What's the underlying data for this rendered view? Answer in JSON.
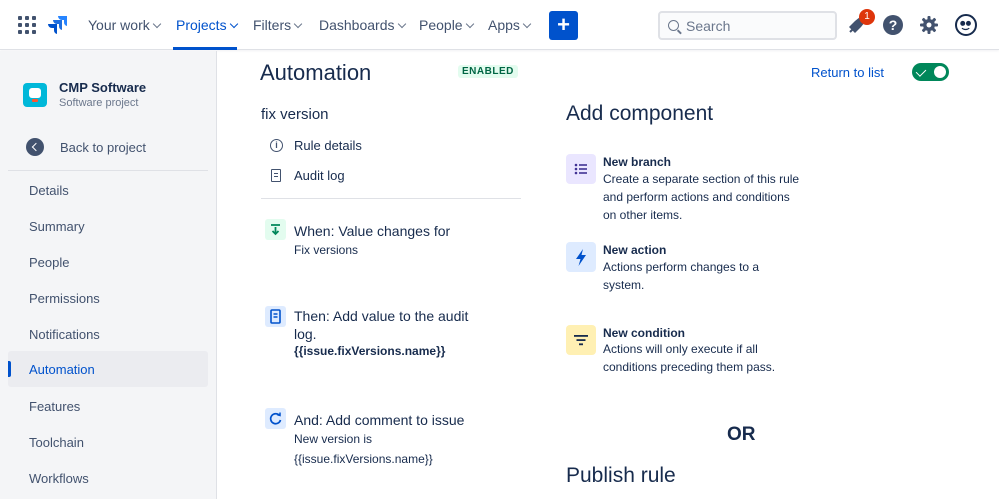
{
  "topnav": {
    "items": [
      {
        "label": "Your work",
        "active": false
      },
      {
        "label": "Projects",
        "active": true
      },
      {
        "label": "Filters",
        "active": false
      },
      {
        "label": "Dashboards",
        "active": false
      },
      {
        "label": "People",
        "active": false
      },
      {
        "label": "Apps",
        "active": false
      }
    ],
    "create_label": "+",
    "search_placeholder": "Search",
    "notification_count": "1",
    "help_label": "?",
    "icons": [
      "app-grid-icon",
      "jira-logo-icon",
      "notification-icon",
      "help-icon",
      "gear-icon",
      "avatar"
    ],
    "accent_color": "#0052cc",
    "badge_color": "#de350b"
  },
  "sidebar": {
    "project_name": "CMP Software",
    "project_type": "Software project",
    "back_label": "Back to project",
    "items": [
      {
        "label": "Details",
        "active": false
      },
      {
        "label": "Summary",
        "active": false
      },
      {
        "label": "People",
        "active": false
      },
      {
        "label": "Permissions",
        "active": false
      },
      {
        "label": "Notifications",
        "active": false
      },
      {
        "label": "Automation",
        "active": true
      },
      {
        "label": "Features",
        "active": false
      },
      {
        "label": "Toolchain",
        "active": false
      },
      {
        "label": "Workflows",
        "active": false
      }
    ]
  },
  "main": {
    "title": "Automation",
    "status": "ENABLED",
    "return_link": "Return to list",
    "rule_enabled": true,
    "rule_name": "fix version",
    "rule_links": [
      {
        "label": "Rule details",
        "icon": "info-icon"
      },
      {
        "label": "Audit log",
        "icon": "document-icon"
      }
    ],
    "steps": [
      {
        "title": "When: Value changes for",
        "line1": "Fix versions",
        "line2": "",
        "icon": "trigger-icon"
      },
      {
        "title": "Then: Add value to the audit log.",
        "line1": "{{issue.fixVersions.name}}",
        "line2": "",
        "icon": "audit-log-action-icon"
      },
      {
        "title": "And: Add comment to issue",
        "line1": "New version is",
        "line2": "{{issue.fixVersions.name}}",
        "icon": "comment-action-icon"
      }
    ]
  },
  "add_component": {
    "title": "Add component",
    "components": [
      {
        "name": "New branch",
        "desc": "Create a separate section of this rule and perform actions and conditions on other items.",
        "icon": "branch-list-icon"
      },
      {
        "name": "New action",
        "desc": "Actions perform changes to a system.",
        "icon": "lightning-icon"
      },
      {
        "name": "New condition",
        "desc": "Actions will only execute if all conditions preceding them pass.",
        "icon": "filter-icon"
      }
    ],
    "or_label": "OR",
    "publish_title": "Publish rule"
  }
}
